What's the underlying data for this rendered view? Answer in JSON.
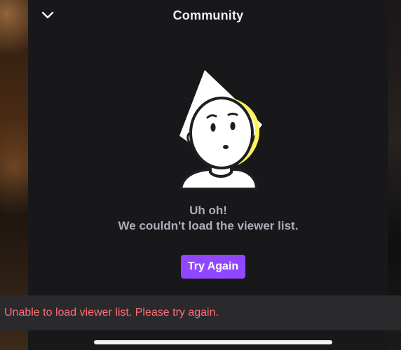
{
  "header": {
    "title": "Community",
    "back_icon": "chevron-down-icon"
  },
  "empty_state": {
    "illustration_icon": "confused-face-icon",
    "line1": "Uh oh!",
    "line2": "We couldn't load the viewer list."
  },
  "actions": {
    "try_again_label": "Try Again"
  },
  "toast": {
    "message": "Unable to load viewer list. Please try again."
  },
  "colors": {
    "accent": "#9147ff",
    "error_text": "#ff6e74",
    "panel_bg": "#18181b",
    "toast_bg": "#2a2a2d",
    "illustration_highlight": "#fff35c"
  }
}
